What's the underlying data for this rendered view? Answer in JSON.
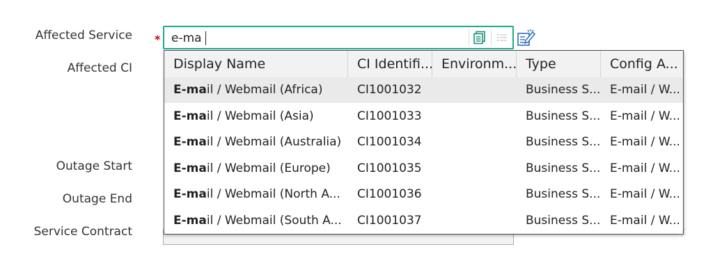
{
  "form": {
    "labels": {
      "affected_service": "Affected Service",
      "affected_ci": "Affected CI",
      "outage_start": "Outage Start",
      "outage_end": "Outage End",
      "service_contract": "Service Contract"
    },
    "required_marker": "*",
    "affected_service_value": "e-ma"
  },
  "icons": {
    "lookup": "lookup-list-icon",
    "list": "list-icon",
    "edit": "edit-record-icon"
  },
  "colors": {
    "focus_border": "#1aaa8c",
    "required": "#d0021b",
    "icon_teal": "#1a8f7a",
    "icon_blue": "#2a6eb5"
  },
  "dropdown": {
    "headers": [
      "Display Name",
      "CI Identifi...",
      "Environm...",
      "Type",
      "Config A..."
    ],
    "rows": [
      {
        "match": "E-ma",
        "rest": "il / Webmail (Africa)",
        "id": "CI1001032",
        "env": "",
        "type": "Business S...",
        "config": "E-mail / W..."
      },
      {
        "match": "E-ma",
        "rest": "il / Webmail (Asia)",
        "id": "CI1001033",
        "env": "",
        "type": "Business S...",
        "config": "E-mail / W..."
      },
      {
        "match": "E-ma",
        "rest": "il / Webmail (Australia)",
        "id": "CI1001034",
        "env": "",
        "type": "Business S...",
        "config": "E-mail / W..."
      },
      {
        "match": "E-ma",
        "rest": "il / Webmail (Europe)",
        "id": "CI1001035",
        "env": "",
        "type": "Business S...",
        "config": "E-mail / W..."
      },
      {
        "match": "E-ma",
        "rest": "il / Webmail (North A...",
        "id": "CI1001036",
        "env": "",
        "type": "Business S...",
        "config": "E-mail / W..."
      },
      {
        "match": "E-ma",
        "rest": "il / Webmail (South A...",
        "id": "CI1001037",
        "env": "",
        "type": "Business S...",
        "config": "E-mail / W..."
      }
    ]
  }
}
